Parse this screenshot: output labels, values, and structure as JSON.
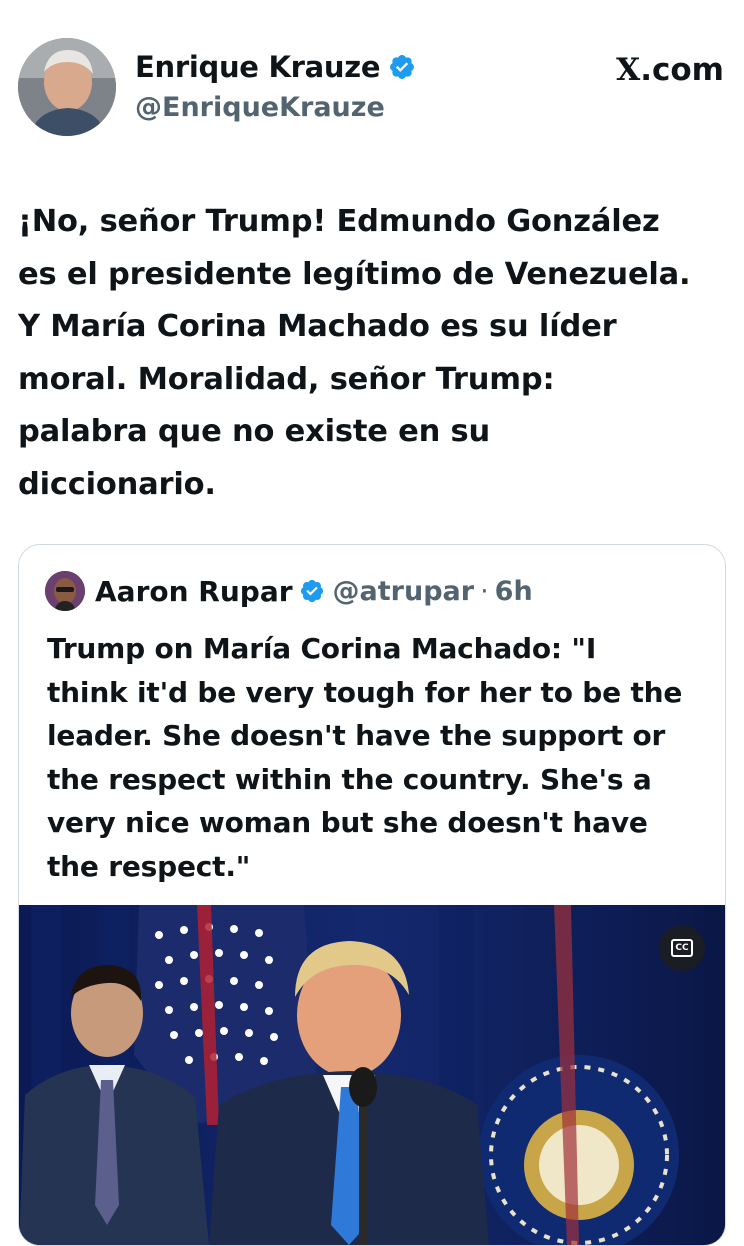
{
  "author": {
    "name": "Enrique Krauze",
    "handle": "@EnriqueKrauze",
    "verified_icon": "verified-badge-icon"
  },
  "brand": {
    "x_glyph": "X",
    "domain": ".com"
  },
  "post": {
    "lines": [
      "¡No, señor Trump! Edmundo González",
      "es el presidente legítimo de Venezuela.",
      "Y María Corina Machado es su líder",
      "moral. Moralidad, señor Trump:",
      "palabra que no existe en su",
      "diccionario."
    ]
  },
  "quoted": {
    "name": "Aaron Rupar",
    "handle": "@atrupar",
    "separator": "·",
    "time": "6h",
    "lines": [
      "Trump on María Corina Machado: \"I",
      "think it'd be very tough for her to be the",
      "leader. She doesn't have the support or",
      "the respect within the country. She's a",
      "very nice woman but she doesn't have",
      "the respect.\""
    ],
    "cc_label": "CC"
  },
  "colors": {
    "verified_blue": "#1d9bf0",
    "secondary_text": "#536471",
    "border": "#cfd9de"
  }
}
